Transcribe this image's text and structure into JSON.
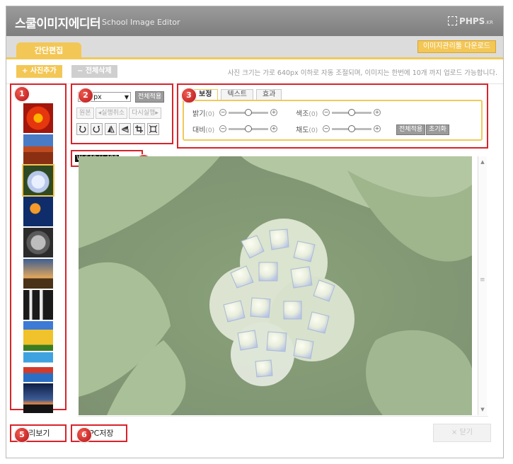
{
  "app": {
    "title_ko": "스쿨이미지에디터",
    "title_en": "School Image Editor",
    "brand": "PHPS",
    "brand_suffix": ".KR"
  },
  "tabs": {
    "simple_edit": "간단편집",
    "download_program": "이미지관리툴 다운로드"
  },
  "toolbar": {
    "add_photo": "+ 사진추가",
    "delete_all": "− 전체삭제",
    "notice": "사진 크기는 가로 640px 이하로 자동 조절되며, 이미지는 한번에 10개 까지 업로드 가능합니다."
  },
  "badges": [
    "1",
    "2",
    "3",
    "4",
    "5",
    "6"
  ],
  "thumbnails": [
    {
      "name": "red-flower",
      "selected": false
    },
    {
      "name": "red-rocks",
      "selected": false
    },
    {
      "name": "hydrangea",
      "selected": true
    },
    {
      "name": "jellyfish",
      "selected": false
    },
    {
      "name": "koala",
      "selected": false
    },
    {
      "name": "lighthouse",
      "selected": false
    },
    {
      "name": "penguins",
      "selected": false
    },
    {
      "name": "tulips",
      "selected": false
    },
    {
      "name": "poster",
      "selected": false
    },
    {
      "name": "sunset",
      "selected": false
    }
  ],
  "resize": {
    "selected_size": "580px",
    "apply_all": "전체적용"
  },
  "history": {
    "original": "원본",
    "undo": "실행취소",
    "redo": "다시실행"
  },
  "tools": [
    "rotate-left-icon",
    "rotate-right-icon",
    "flip-horizontal-icon",
    "flip-vertical-icon",
    "crop-icon",
    "fit-icon"
  ],
  "adjust_tabs": [
    "보정",
    "텍스트",
    "효과"
  ],
  "adjust": {
    "brightness_label": "밝기",
    "brightness_value": "(0)",
    "contrast_label": "대비",
    "contrast_value": "(0)",
    "hue_label": "색조",
    "hue_value": "(0)",
    "saturation_label": "채도",
    "saturation_value": "(0)",
    "apply_all": "전체적용",
    "reset": "초기화"
  },
  "image_size_label": "W:640 H:480",
  "footer": {
    "preview": "미리보기",
    "pc_save": "PC저장",
    "close": "× 닫기"
  },
  "colors": {
    "accent": "#f3c756",
    "highlight_red": "#d8232a",
    "titlebar": "#8c8c8c"
  }
}
